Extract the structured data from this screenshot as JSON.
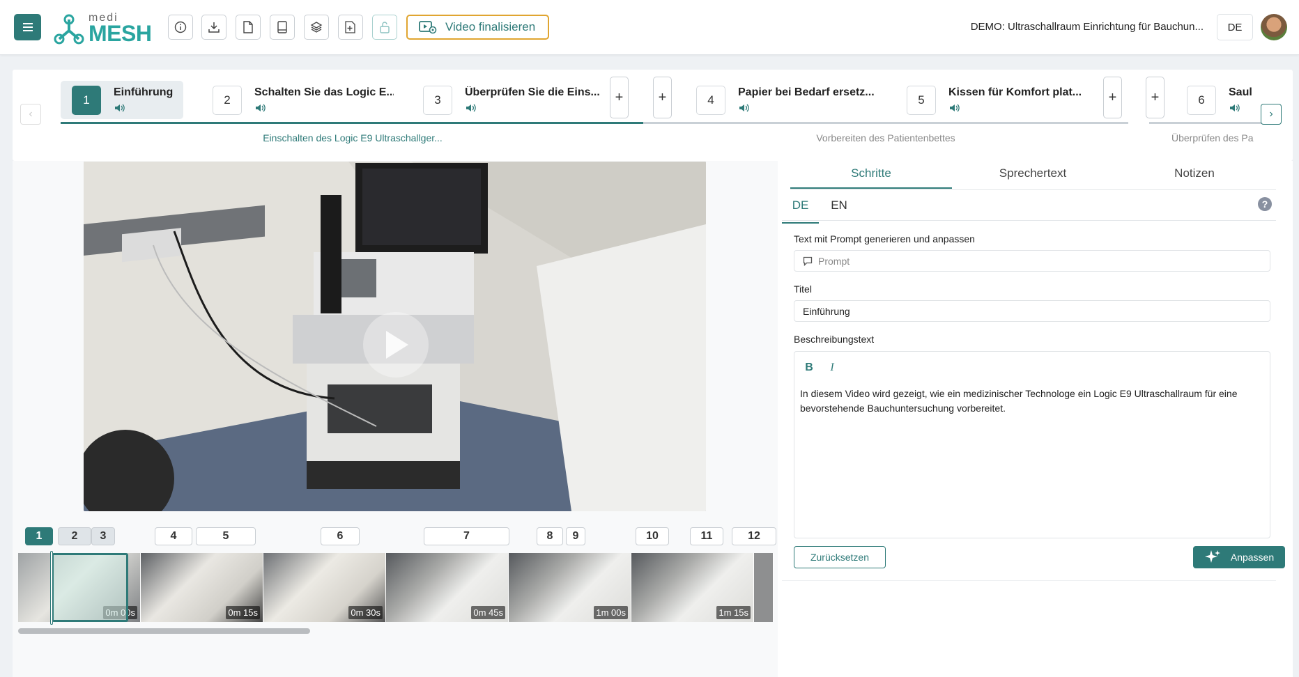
{
  "header": {
    "logo_top": "medi",
    "logo_bottom": "MESH",
    "finalize_label": "Video finalisieren",
    "demo_title": "DEMO: Ultraschallraum Einrichtung für Bauchun...",
    "language": "DE",
    "tool_icons": [
      "info-icon",
      "download-icon",
      "document-icon",
      "book-icon",
      "layers-icon",
      "add-file-icon",
      "lock-icon"
    ]
  },
  "stepper": {
    "steps": [
      {
        "num": "1",
        "title": "Einführung"
      },
      {
        "num": "2",
        "title": "Schalten Sie das Logic E..."
      },
      {
        "num": "3",
        "title": "Überprüfen Sie die Eins..."
      },
      {
        "num": "4",
        "title": "Papier bei Bedarf ersetz..."
      },
      {
        "num": "5",
        "title": "Kissen für Komfort plat..."
      },
      {
        "num": "6",
        "title": "Saul"
      }
    ],
    "plus": "+",
    "groups": [
      {
        "label": "Einschalten des Logic E9 Ultraschallger..."
      },
      {
        "label": "Vorbereiten des Patientenbettes"
      },
      {
        "label": "Überprüfen des Pa"
      }
    ],
    "prev": "‹",
    "next": "›"
  },
  "timeline": {
    "markers": [
      "1",
      "2",
      "3",
      "4",
      "5",
      "6",
      "7",
      "8",
      "9",
      "10",
      "11",
      "12"
    ],
    "frames": [
      "0m 00s",
      "0m 15s",
      "0m 30s",
      "0m 45s",
      "1m 00s",
      "1m 15s"
    ]
  },
  "panel": {
    "tabs": [
      "Schritte",
      "Sprechertext",
      "Notizen"
    ],
    "lang_tabs": [
      "DE",
      "EN"
    ],
    "help": "?",
    "prompt_label": "Text mit Prompt generieren und anpassen",
    "prompt_placeholder": "Prompt",
    "title_label": "Titel",
    "title_value": "Einführung",
    "desc_label": "Beschreibungstext",
    "bold": "B",
    "italic": "I",
    "desc_text": "In diesem Video wird gezeigt, wie ein medizinischer Technologe ein Logic E9 Ultraschallraum für eine bevorstehende Bauchuntersuchung vorbereitet.",
    "reset_label": "Zurücksetzen",
    "apply_label": "Anpassen"
  },
  "colors": {
    "accent": "#2e7a78",
    "finalize_border": "#e0a530"
  }
}
